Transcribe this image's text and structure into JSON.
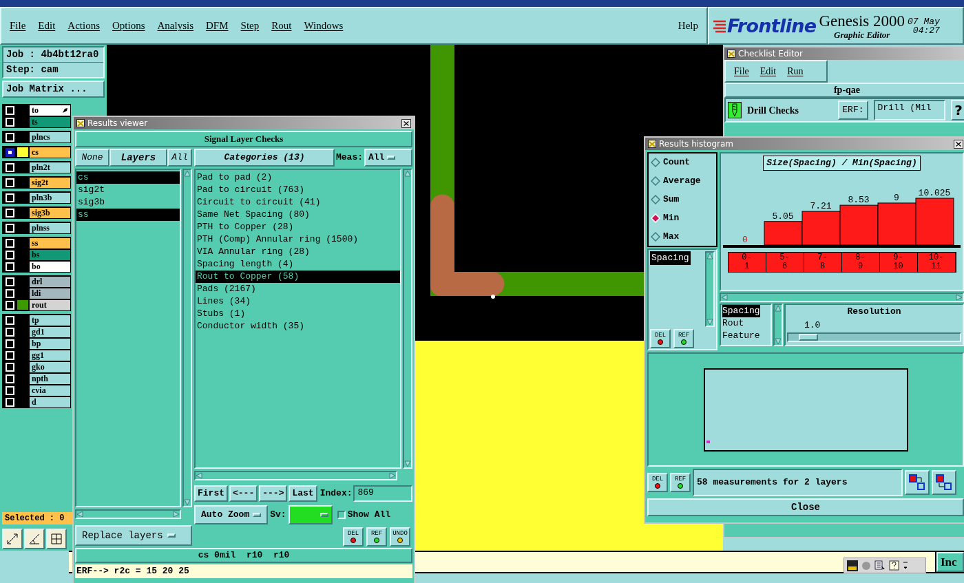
{
  "menu": [
    {
      "label": "File"
    },
    {
      "label": "Edit"
    },
    {
      "label": "Actions"
    },
    {
      "label": "Options"
    },
    {
      "label": "Analysis"
    },
    {
      "label": "DFM"
    },
    {
      "label": "Step"
    },
    {
      "label": "Rout"
    },
    {
      "label": "Windows"
    }
  ],
  "help": "Help",
  "brand": {
    "logo": "Frontline",
    "product": "Genesis 2000",
    "subtitle": "Graphic Editor",
    "date": "07 May",
    "time": "04:27"
  },
  "job": "Job : 4b4bt12ra0",
  "step": "Step: cam",
  "job_matrix": "Job Matrix ...",
  "layer_groups": [
    [
      {
        "name": "to",
        "color": "#ffffff",
        "selected": false
      },
      {
        "name": "ts",
        "color": "#119977",
        "selected": false
      }
    ],
    [
      {
        "name": "plncs",
        "color": "#a0dcdc",
        "selected": false
      }
    ],
    [
      {
        "name": "cs",
        "color": "#ffc04c",
        "selected": true,
        "swatch": {
          "color": "#ffff33"
        }
      }
    ],
    [
      {
        "name": "pln2t",
        "color": "#a0dcdc",
        "selected": false
      }
    ],
    [
      {
        "name": "sig2t",
        "color": "#ffc04c",
        "selected": false
      }
    ],
    [
      {
        "name": "pln3b",
        "color": "#a0dcdc",
        "selected": false
      }
    ],
    [
      {
        "name": "sig3b",
        "color": "#ffc04c",
        "selected": false
      }
    ],
    [
      {
        "name": "plnss",
        "color": "#a0dcdc",
        "selected": false
      }
    ],
    [
      {
        "name": "ss",
        "color": "#ffc04c",
        "selected": false
      },
      {
        "name": "bs",
        "color": "#119977",
        "selected": false
      },
      {
        "name": "bo",
        "color": "#ffffff",
        "selected": false
      }
    ],
    [
      {
        "name": "drl",
        "color": "#a4b8c0",
        "selected": false
      },
      {
        "name": "ldi",
        "color": "#a4b8c0",
        "selected": false
      },
      {
        "name": "rout",
        "color": "#d4d4d4",
        "selected": false,
        "swatch": {
          "color": "#3c9a00"
        }
      }
    ],
    [
      {
        "name": "tp",
        "color": "#a0dcdc",
        "selected": false
      },
      {
        "name": "gd1",
        "color": "#a0dcdc",
        "selected": false
      },
      {
        "name": "bp",
        "color": "#a0dcdc",
        "selected": false
      },
      {
        "name": "gg1",
        "color": "#a0dcdc",
        "selected": false
      },
      {
        "name": "gko",
        "color": "#a0dcdc",
        "selected": false
      },
      {
        "name": "npth",
        "color": "#a0dcdc",
        "selected": false
      },
      {
        "name": "cvia",
        "color": "#a0dcdc",
        "selected": false
      },
      {
        "name": "d",
        "color": "#a0dcdc",
        "selected": false
      }
    ]
  ],
  "selected_count": "Selected : 0",
  "results_viewer": {
    "title": "Results viewer",
    "header": "Signal Layer Checks",
    "none": "None",
    "layers": "Layers",
    "all": "All",
    "categories": "Categories (13)",
    "meas_label": "Meas:",
    "meas_value": "All",
    "layer_list": [
      {
        "name": "cs",
        "selected": true
      },
      {
        "name": "sig2t",
        "selected": false
      },
      {
        "name": "sig3b",
        "selected": false
      },
      {
        "name": "ss",
        "selected": true
      }
    ],
    "category_list": [
      {
        "label": "Pad to pad (2)",
        "selected": false
      },
      {
        "label": "Pad to circuit (763)",
        "selected": false
      },
      {
        "label": "Circuit to circuit (41)",
        "selected": false
      },
      {
        "label": "Same Net Spacing (80)",
        "selected": false
      },
      {
        "label": "PTH to Copper (28)",
        "selected": false
      },
      {
        "label": "PTH (Comp) Annular ring (1500)",
        "selected": false
      },
      {
        "label": "VIA Annular ring (28)",
        "selected": false
      },
      {
        "label": "Spacing length (4)",
        "selected": false
      },
      {
        "label": "Rout to Copper (58)",
        "selected": true
      },
      {
        "label": "Pads (2167)",
        "selected": false
      },
      {
        "label": "Lines (34)",
        "selected": false
      },
      {
        "label": "Stubs (1)",
        "selected": false
      },
      {
        "label": "Conductor width (35)",
        "selected": false
      }
    ],
    "nav": [
      "First",
      "<---",
      "--->",
      "Last"
    ],
    "index_label": "Index:",
    "index_value": "869",
    "auto_zoom": "Auto Zoom",
    "sv_label": "Sv:",
    "show_all": {
      "label": "Show All",
      "checked": false
    },
    "replace_layers": "Replace layers",
    "del": "DEL",
    "ref": "REF",
    "undo": "UNDO",
    "info": "cs 0mil  r10  r10",
    "erf": "ERF--> r2c = 15 20 25"
  },
  "checklist": {
    "title": "Checklist Editor",
    "menu": [
      "File",
      "Edit",
      "Run"
    ],
    "name": "fp-qae",
    "check": "Drill Checks",
    "erf_label": "ERF:",
    "erf_value": "Drill (Mil",
    "help": "?"
  },
  "histogram": {
    "title": "Results histogram",
    "modes": [
      {
        "label": "Count",
        "selected": false
      },
      {
        "label": "Average",
        "selected": false
      },
      {
        "label": "Sum",
        "selected": false
      },
      {
        "label": "Min",
        "selected": true
      },
      {
        "label": "Max",
        "selected": false
      }
    ],
    "list": [
      {
        "label": "Spacing",
        "selected": true
      }
    ],
    "chart_data": {
      "type": "bar",
      "title": "Size(Spacing) / Min(Spacing)",
      "categories": [
        "0-1",
        "5-6",
        "7-8",
        "8-9",
        "9-10",
        "10-11"
      ],
      "values": [
        0,
        5.05,
        7.21,
        8.53,
        9,
        10.025
      ],
      "data_labels": true
    },
    "list_del": "DEL",
    "list_ref": "REF",
    "fields": [
      {
        "label": "Spacing",
        "selected": true
      },
      {
        "label": "Rout",
        "selected": false
      },
      {
        "label": "Feature",
        "selected": false
      }
    ],
    "resolution": "Resolution",
    "resolution_value": "1.0",
    "resolution_slider": {
      "level": 0.06
    },
    "del": "DEL",
    "ref": "REF",
    "status": "58 measurements for 2 layers",
    "close": "Close"
  },
  "inc": "Inc"
}
